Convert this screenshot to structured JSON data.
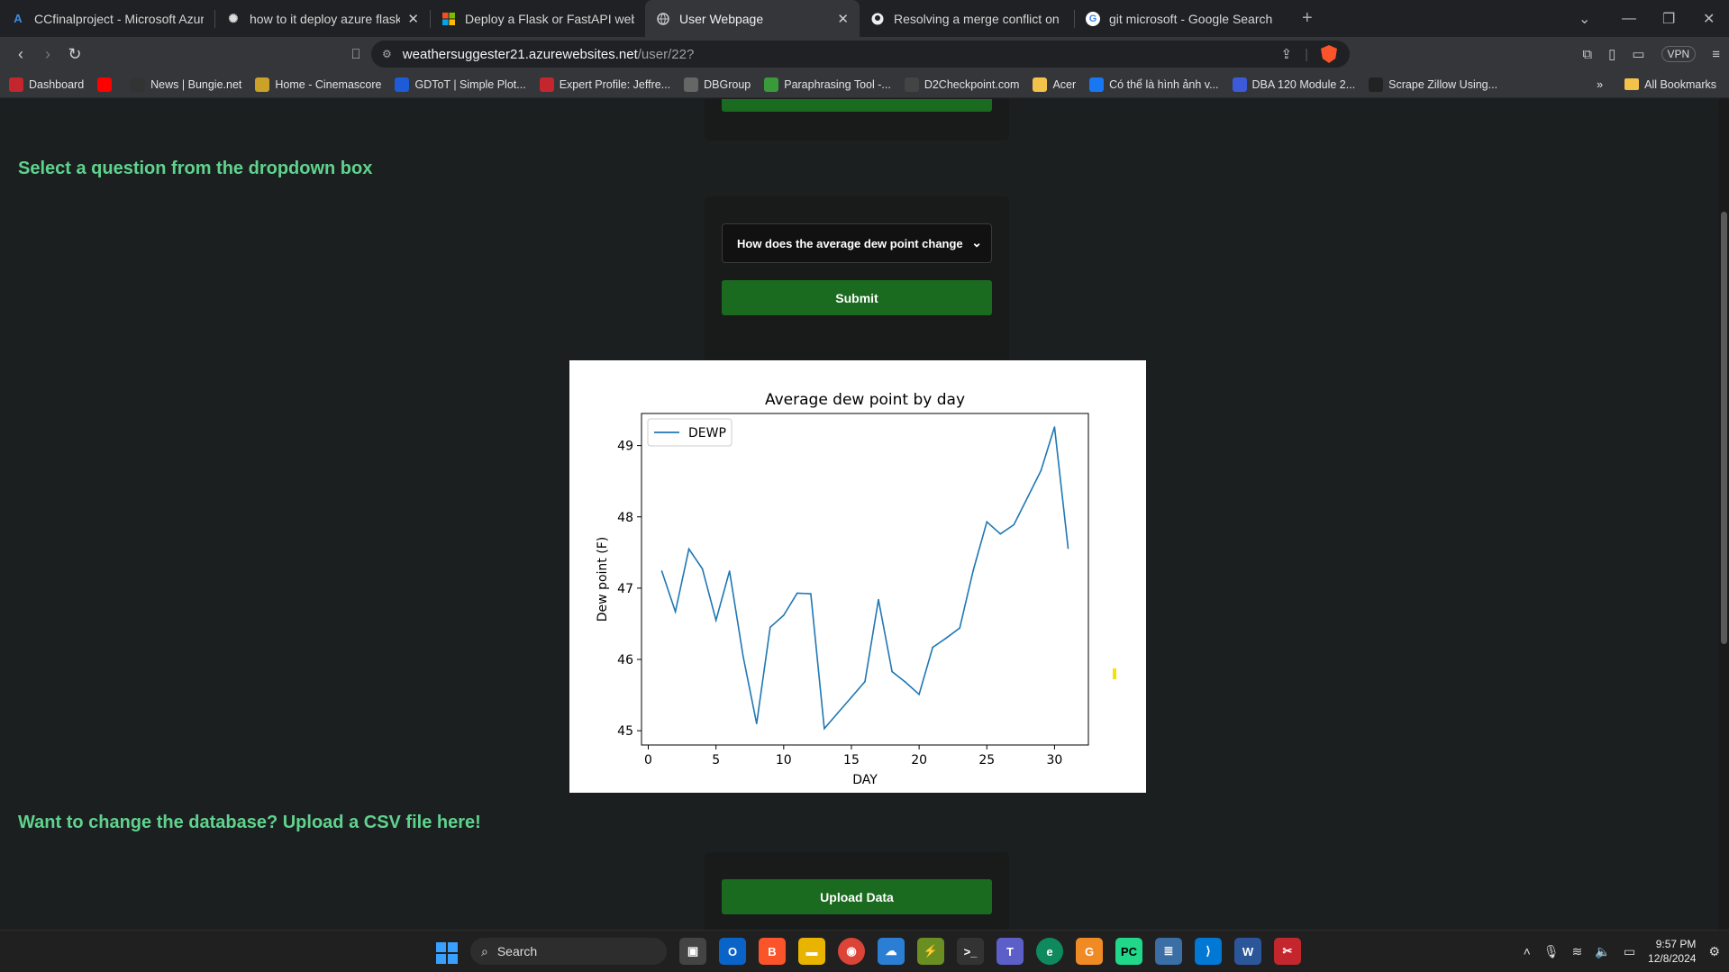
{
  "tabs": [
    {
      "label": "CCfinalproject - Microsoft Azure",
      "icon": "azure-icon"
    },
    {
      "label": "how to it deploy azure flask web",
      "icon": "openai-icon",
      "close": "✕"
    },
    {
      "label": "Deploy a Flask or FastAPI web app o",
      "icon": "microsoft-icon"
    },
    {
      "label": "User Webpage",
      "icon": "globe-icon",
      "close": "✕",
      "active": true
    },
    {
      "label": "Resolving a merge conflict on GitHu",
      "icon": "github-icon"
    },
    {
      "label": "git microsoft - Google Search",
      "icon": "google-icon"
    }
  ],
  "address_bar": {
    "url_host": "weathersuggester21.azurewebsites.net",
    "url_path": "/user/22?"
  },
  "vpn_label": "VPN",
  "bookmarks": [
    {
      "label": "Dashboard",
      "color": "#c4262e"
    },
    {
      "label": "",
      "color": "#ff0000"
    },
    {
      "label": "News | Bungie.net",
      "color": "#333333"
    },
    {
      "label": "Home - Cinemascore",
      "color": "#c9a227"
    },
    {
      "label": "GDToT | Simple Plot...",
      "color": "#1e5bd8"
    },
    {
      "label": "Expert Profile: Jeffre...",
      "color": "#c4262e"
    },
    {
      "label": "DBGroup",
      "color": "#666666"
    },
    {
      "label": "Paraphrasing Tool -...",
      "color": "#3a9a3a"
    },
    {
      "label": "D2Checkpoint.com",
      "color": "#444444"
    },
    {
      "label": "Acer",
      "color": "#f3c24b"
    },
    {
      "label": "Có thể là hình ảnh v...",
      "color": "#1877f2"
    },
    {
      "label": "DBA 120 Module 2...",
      "color": "#3b5bdb"
    },
    {
      "label": "Scrape Zillow Using...",
      "color": "#222222"
    }
  ],
  "all_bookmarks_label": "All Bookmarks",
  "page": {
    "select_heading": "Select a question from the dropdown box",
    "question_selected": "How does the average dew point change by day?",
    "submit_label": "Submit",
    "upload_heading": "Want to change the database? Upload a CSV file here!",
    "upload_label": "Upload Data"
  },
  "chart_data": {
    "type": "line",
    "title": "Average dew point by day",
    "xlabel": "DAY",
    "ylabel": "Dew point (F)",
    "xlim": [
      -0.5,
      32.5
    ],
    "ylim": [
      44.8,
      49.45
    ],
    "xticks": [
      0,
      5,
      10,
      15,
      20,
      25,
      30
    ],
    "yticks": [
      45,
      46,
      47,
      48,
      49
    ],
    "legend": "top-left",
    "grid": false,
    "series": [
      {
        "name": "DEWP",
        "color": "#1f77b4",
        "x": [
          1,
          2,
          3,
          4,
          5,
          6,
          7,
          8,
          9,
          10,
          11,
          12,
          13,
          14,
          15,
          16,
          17,
          18,
          19,
          20,
          21,
          22,
          23,
          24,
          25,
          26,
          27,
          28,
          29,
          30,
          31
        ],
        "y": [
          47.24,
          46.67,
          47.55,
          47.27,
          46.55,
          47.24,
          46.05,
          45.1,
          46.45,
          46.62,
          46.93,
          46.92,
          45.03,
          45.25,
          45.47,
          45.69,
          46.84,
          45.83,
          45.68,
          45.51,
          46.17,
          46.3,
          46.44,
          47.25,
          47.93,
          47.76,
          47.89,
          48.27,
          48.65,
          49.26,
          47.56
        ]
      }
    ]
  },
  "taskbar": {
    "search_label": "Search",
    "time": "9:57 PM",
    "date": "12/8/2024"
  }
}
